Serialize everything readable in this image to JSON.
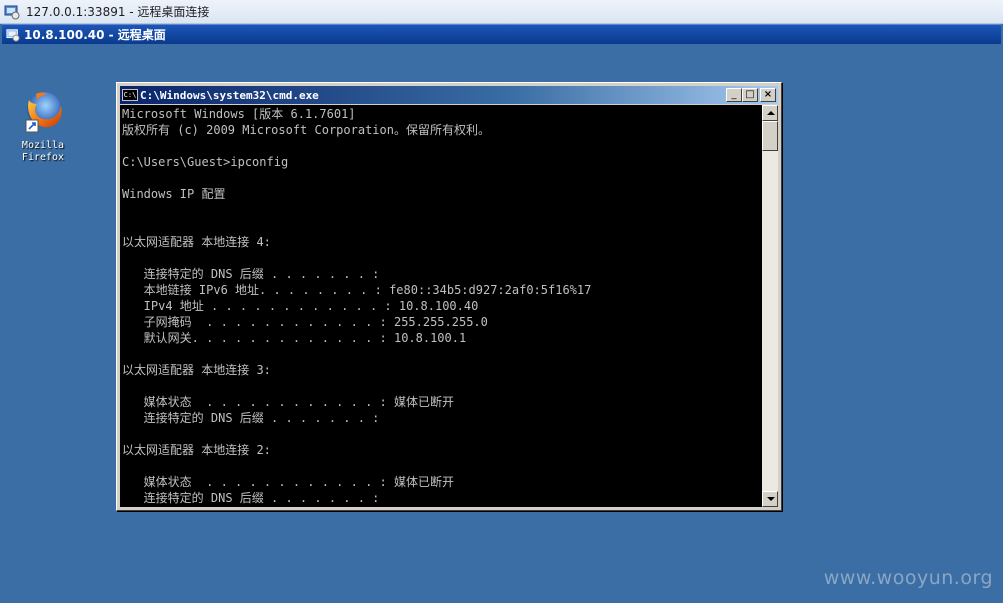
{
  "client_window": {
    "title": "127.0.0.1:33891 - 远程桌面连接",
    "connection_bar_title": "10.8.100.40 - 远程桌面"
  },
  "desktop": {
    "icons": [
      {
        "label": "Mozilla\nFirefox",
        "icon": "firefox-icon"
      }
    ]
  },
  "cmd_window": {
    "title": "C:\\Windows\\system32\\cmd.exe",
    "buttons": {
      "minimize": "_",
      "maximize": "□",
      "close": "×"
    },
    "lines": [
      "Microsoft Windows [版本 6.1.7601]",
      "版权所有 (c) 2009 Microsoft Corporation。保留所有权利。",
      "",
      "C:\\Users\\Guest>ipconfig",
      "",
      "Windows IP 配置",
      "",
      "",
      "以太网适配器 本地连接 4:",
      "",
      "   连接特定的 DNS 后缀 . . . . . . . :",
      "   本地链接 IPv6 地址. . . . . . . . : fe80::34b5:d927:2af0:5f16%17",
      "   IPv4 地址 . . . . . . . . . . . . : 10.8.100.40",
      "   子网掩码  . . . . . . . . . . . . : 255.255.255.0",
      "   默认网关. . . . . . . . . . . . . : 10.8.100.1",
      "",
      "以太网适配器 本地连接 3:",
      "",
      "   媒体状态  . . . . . . . . . . . . : 媒体已断开",
      "   连接特定的 DNS 后缀 . . . . . . . :",
      "",
      "以太网适配器 本地连接 2:",
      "",
      "   媒体状态  . . . . . . . . . . . . : 媒体已断开",
      "   连接特定的 DNS 后缀 . . . . . . . :"
    ]
  },
  "watermark": "www.wooyun.org",
  "colors": {
    "desktop_bg": "#3a6ea5",
    "console_bg": "#000000",
    "console_text": "#c0c0c0",
    "titlebar": "#0a246a"
  }
}
